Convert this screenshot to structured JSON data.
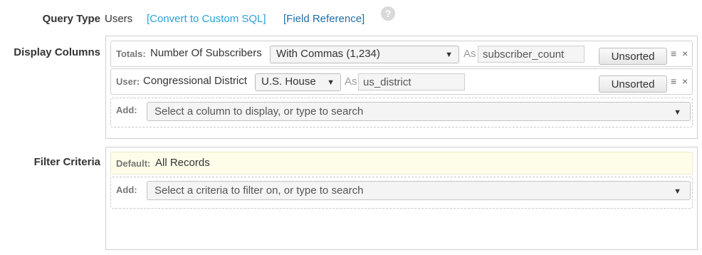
{
  "query_type": {
    "label": "Query Type",
    "value": "Users",
    "convert_link": "[Convert to Custom SQL]",
    "reference_link": "[Field Reference]",
    "help_glyph": "?"
  },
  "display_columns": {
    "label": "Display Columns",
    "rows": [
      {
        "prefix": "Totals:",
        "column": "Number Of Subscribers",
        "format": "With Commas (1,234)",
        "as_label": "As",
        "alias": "subscriber_count",
        "sort": "Unsorted"
      },
      {
        "prefix": "User:",
        "column": "Congressional District",
        "format": "U.S. House",
        "as_label": "As",
        "alias": "us_district",
        "sort": "Unsorted"
      }
    ],
    "add": {
      "prefix": "Add:",
      "placeholder": "Select a column to display, or type to search"
    }
  },
  "filter_criteria": {
    "label": "Filter Criteria",
    "default": {
      "prefix": "Default:",
      "value": "All Records"
    },
    "add": {
      "prefix": "Add:",
      "placeholder": "Select a criteria to filter on, or type to search"
    }
  },
  "icons": {
    "reorder": "≡",
    "remove": "×",
    "dropdown": "▼"
  },
  "colors": {
    "link_primary": "#2aa3d6",
    "link_secondary": "#1f6fa8",
    "default_row_bg": "#fdfde9"
  }
}
